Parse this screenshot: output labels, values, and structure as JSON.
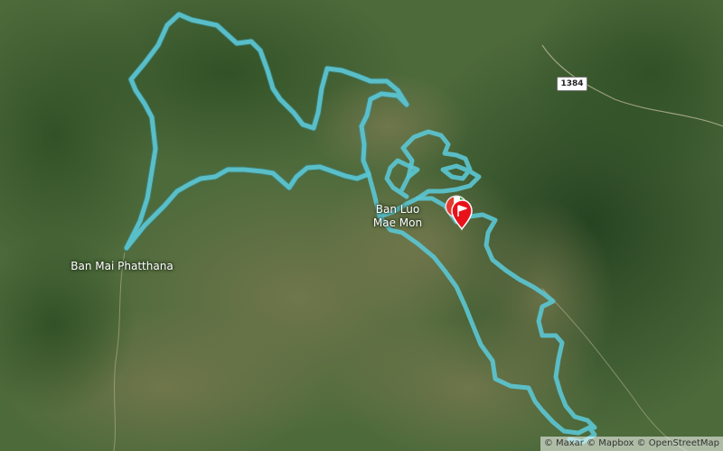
{
  "map": {
    "places": [
      {
        "name": "Ban Mai Phatthana"
      },
      {
        "name": "Ban Luo Mae Mon"
      }
    ],
    "road_shield": "1384",
    "attribution": "© Maxar © Mapbox © OpenStreetMap",
    "route_color": "#5bc4d0",
    "marker_color": "#e8121b",
    "start_flag_colors": [
      "#e23b2e",
      "#ffffff",
      "#2e9e3f"
    ]
  }
}
